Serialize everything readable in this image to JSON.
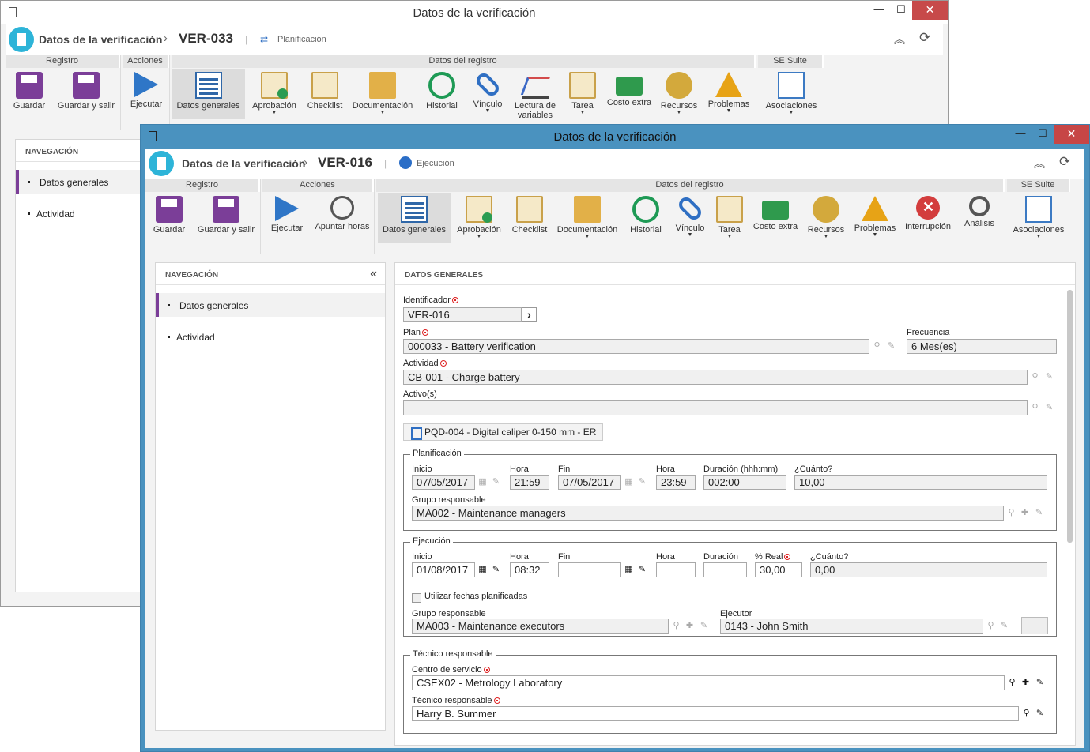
{
  "back": {
    "title": "Datos de la verificación",
    "header": {
      "section": "Datos de la verificación",
      "record": "VER-033",
      "status": "Planificación"
    },
    "groups": [
      "Registro",
      "Acciones",
      "Datos del registro",
      "SE Suite"
    ],
    "buttons": {
      "save": "Guardar",
      "save_exit": "Guardar y salir",
      "execute": "Ejecutar",
      "general": "Datos generales",
      "approval": "Aprobación",
      "checklist": "Checklist",
      "docs": "Documentación",
      "history": "Historial",
      "link": "Vínculo",
      "vars": "Lectura de variables",
      "task": "Tarea",
      "extra_cost": "Costo extra",
      "resources": "Recursos",
      "problems": "Problemas",
      "assoc": "Asociaciones"
    },
    "nav": {
      "title": "NAVEGACIÓN",
      "items": [
        "Datos generales",
        "Actividad"
      ]
    }
  },
  "front": {
    "title": "Datos de la verificación",
    "header": {
      "section": "Datos de la verificación",
      "record": "VER-016",
      "status": "Ejecución"
    },
    "groups": [
      "Registro",
      "Acciones",
      "Datos del registro",
      "SE Suite"
    ],
    "buttons": {
      "save": "Guardar",
      "save_exit": "Guardar y salir",
      "execute": "Ejecutar",
      "hours": "Apuntar horas",
      "general": "Datos generales",
      "approval": "Aprobación",
      "checklist": "Checklist",
      "docs": "Documentación",
      "history": "Historial",
      "link": "Vínculo",
      "task": "Tarea",
      "extra_cost": "Costo extra",
      "resources": "Recursos",
      "problems": "Problemas",
      "interrupt": "Interrupción",
      "analysis": "Análisis",
      "assoc": "Asociaciones"
    },
    "nav": {
      "title": "NAVEGACIÓN",
      "items": [
        "Datos generales",
        "Actividad"
      ]
    },
    "form": {
      "title": "DATOS GENERALES",
      "identifier_label": "Identificador",
      "identifier": "VER-016",
      "plan_label": "Plan",
      "plan": "000033 - Battery verification",
      "freq_label": "Frecuencia",
      "freq": "6 Mes(es)",
      "activity_label": "Actividad",
      "activity": "CB-001 - Charge battery",
      "assets_label": "Activo(s)",
      "assets": "",
      "chip": "PQD-004 - Digital caliper 0-150 mm - ER",
      "planning": {
        "legend": "Planificación",
        "start_label": "Inicio",
        "start": "07/05/2017",
        "hour_label": "Hora",
        "hour": "21:59",
        "end_label": "Fin",
        "end": "07/05/2017",
        "hour2_label": "Hora",
        "hour2": "23:59",
        "dur_label": "Duración (hhh:mm)",
        "dur": "002:00",
        "cost_label": "¿Cuánto?",
        "cost": "10,00",
        "group_label": "Grupo responsable",
        "group": "MA002 - Maintenance managers"
      },
      "execution": {
        "legend": "Ejecución",
        "start_label": "Inicio",
        "start": "01/08/2017",
        "hour_label": "Hora",
        "hour": "08:32",
        "end_label": "Fin",
        "end": "",
        "hour2_label": "Hora",
        "hour2": "",
        "dur_label": "Duración",
        "dur": "",
        "real_label": "% Real",
        "real": "30,00",
        "cost_label": "¿Cuánto?",
        "cost": "0,00",
        "use_planned": "Utilizar fechas planificadas",
        "group_label": "Grupo responsable",
        "group": "MA003 - Maintenance executors",
        "executor_label": "Ejecutor",
        "executor": "0143 - John Smith"
      },
      "tech": {
        "legend": "Técnico responsable",
        "center_label": "Centro de servicio",
        "center": "CSEX02 - Metrology Laboratory",
        "tech_label": "Técnico responsable",
        "tech": "Harry B. Summer"
      }
    }
  }
}
